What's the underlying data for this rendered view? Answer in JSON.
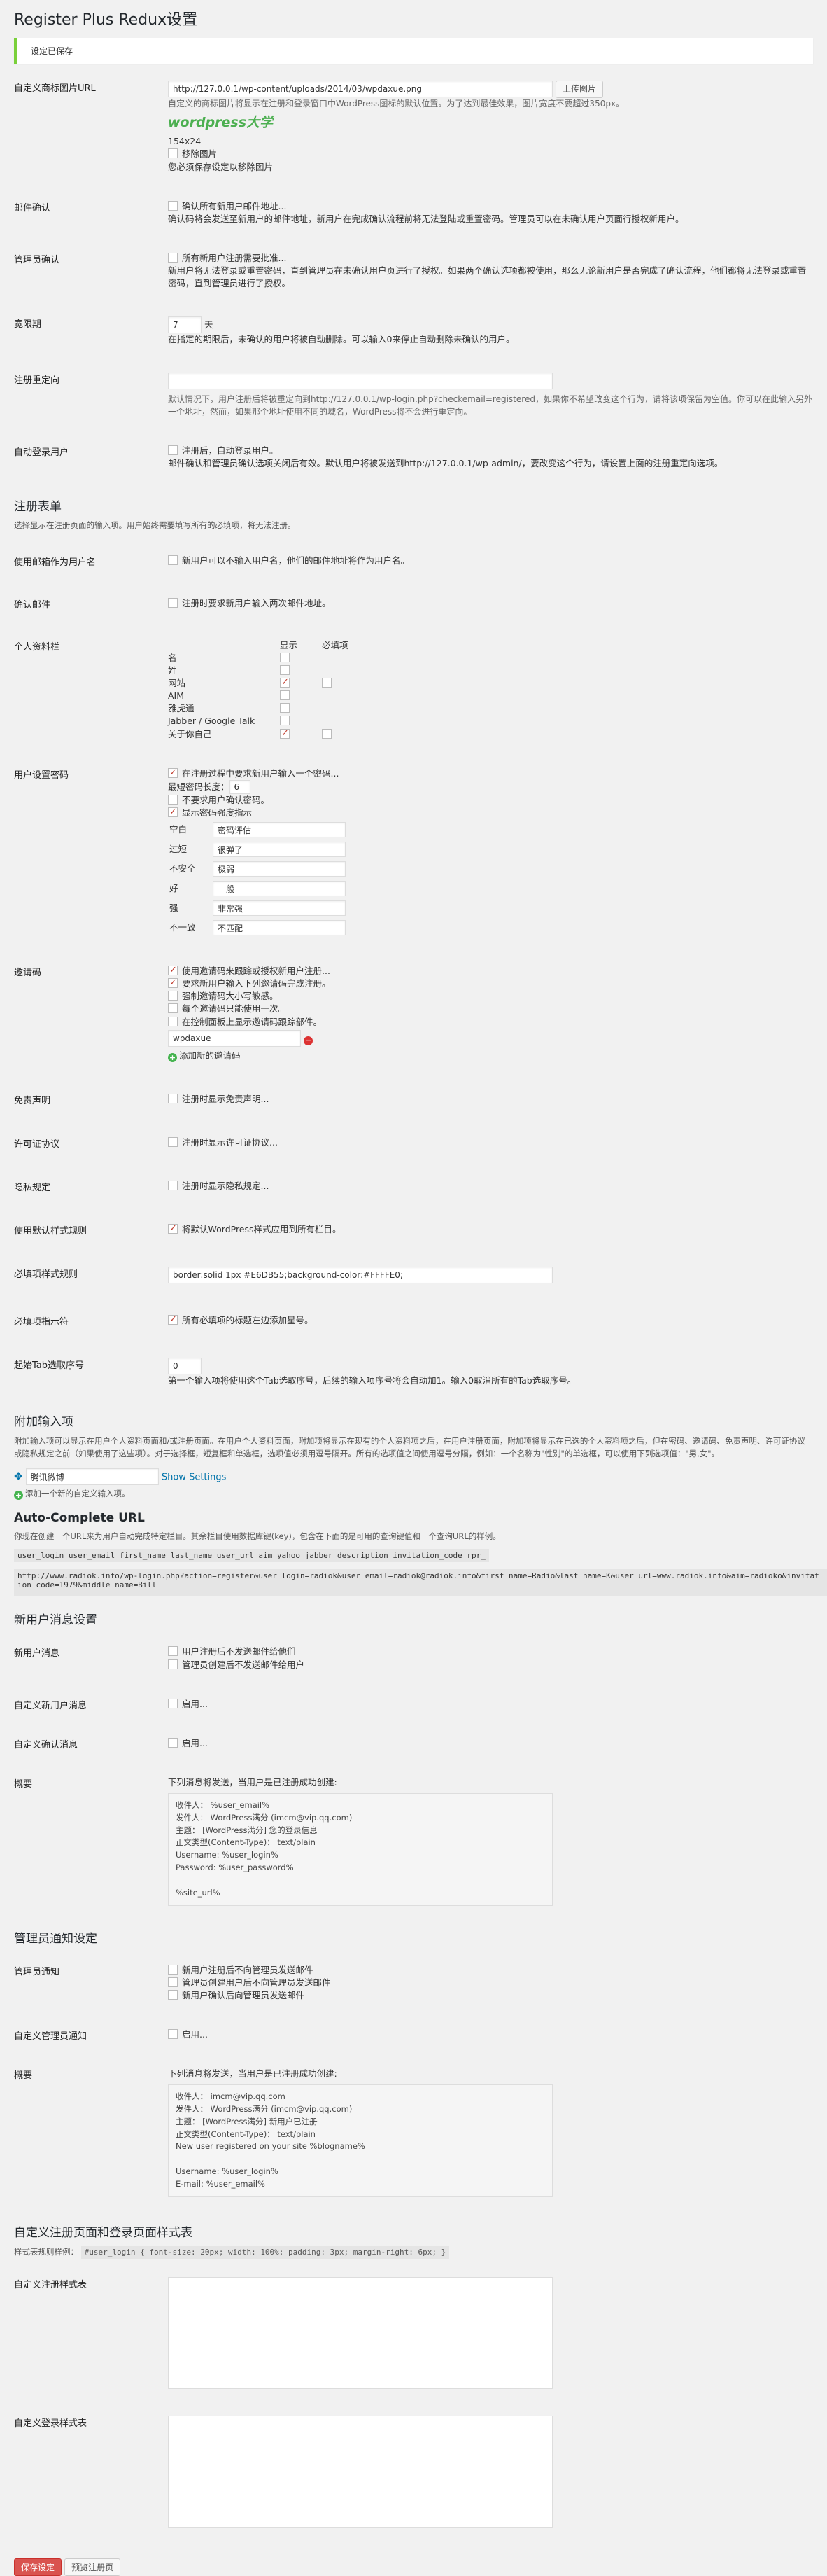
{
  "page": {
    "title": "Register Plus Redux设置",
    "notice": "设定已保存"
  },
  "logo": {
    "label": "自定义商标图片URL",
    "value": "http://127.0.0.1/wp-content/uploads/2014/03/wpdaxue.png",
    "upload_button": "上传图片",
    "desc": "自定义的商标图片将显示在注册和登录窗口中WordPress图标的默认位置。为了达到最佳效果，图片宽度不要超过350px。",
    "image_text": "wordpress大学",
    "size": "154x24",
    "remove_label": "移除图片",
    "remove_note": "您必须保存设定以移除图片"
  },
  "email_verify": {
    "label": "邮件确认",
    "option": "确认所有新用户邮件地址...",
    "desc": "确认码将会发送至新用户的邮件地址，新用户在完成确认流程前将无法登陆或重置密码。管理员可以在未确认用户页面行授权新用户。"
  },
  "admin_verify": {
    "label": "管理员确认",
    "option": "所有新用户注册需要批准...",
    "desc": "新用户将无法登录或重置密码，直到管理员在未确认用户页进行了授权。如果两个确认选项都被使用，那么无论新用户是否完成了确认流程，他们都将无法登录或重置密码，直到管理员进行了授权。"
  },
  "grace": {
    "label": "宽限期",
    "value": "7",
    "unit": "天",
    "desc": "在指定的期限后，未确认的用户将被自动删除。可以输入0来停止自动删除未确认的用户。"
  },
  "redirect": {
    "label": "注册重定向",
    "desc": "默认情况下，用户注册后将被重定向到http://127.0.0.1/wp-login.php?checkemail=registered，如果你不希望改变这个行为，请将该项保留为空值。你可以在此输入另外一个地址，然而，如果那个地址使用不同的域名，WordPress将不会进行重定向。"
  },
  "autologin": {
    "label": "自动登录用户",
    "option": "注册后，自动登录用户。",
    "desc": "邮件确认和管理员确认选项关闭后有效。默认用户将被发送到http://127.0.0.1/wp-admin/，要改变这个行为，请设置上面的注册重定向选项。"
  },
  "reg_form": {
    "heading": "注册表单",
    "desc": "选择显示在注册页面的输入项。用户始终需要填写所有的必填项，将无法注册。",
    "email_username": {
      "label": "使用邮箱作为用户名",
      "option": "新用户可以不输入用户名，他们的邮件地址将作为用户名。"
    },
    "confirm_email": {
      "label": "确认邮件",
      "option": "注册时要求新用户输入两次邮件地址。"
    },
    "profile": {
      "label": "个人资料栏",
      "col_show": "显示",
      "col_required": "必填项",
      "fields": [
        {
          "name": "名",
          "show": false,
          "req": null
        },
        {
          "name": "姓",
          "show": false,
          "req": null
        },
        {
          "name": "网站",
          "show": true,
          "req": false
        },
        {
          "name": "AIM",
          "show": false,
          "req": null
        },
        {
          "name": "雅虎通",
          "show": false,
          "req": null
        },
        {
          "name": "Jabber / Google Talk",
          "show": false,
          "req": null
        },
        {
          "name": "关于你自己",
          "show": true,
          "req": false
        }
      ]
    },
    "password": {
      "label": "用户设置密码",
      "option1": "在注册过程中要求新用户输入一个密码...",
      "minlen_label": "最短密码长度：",
      "minlen": "6",
      "option2": "不要求用户确认密码。",
      "option3": "显示密码强度指示",
      "strength": [
        {
          "key": "空白",
          "value": "密码评估"
        },
        {
          "key": "过短",
          "value": "很弹了"
        },
        {
          "key": "不安全",
          "value": "极弱"
        },
        {
          "key": "好",
          "value": "一般"
        },
        {
          "key": "强",
          "value": "非常强"
        },
        {
          "key": "不一致",
          "value": "不匹配"
        }
      ]
    },
    "invite": {
      "label": "邀请码",
      "options": [
        {
          "text": "使用邀请码来跟踪或授权新用户注册...",
          "checked": true
        },
        {
          "text": "要求新用户输入下列邀请码完成注册。",
          "checked": true
        },
        {
          "text": "强制邀请码大小写敏感。",
          "checked": false
        },
        {
          "text": "每个邀请码只能使用一次。",
          "checked": false
        },
        {
          "text": "在控制面板上显示邀请码跟踪部件。",
          "checked": false
        }
      ],
      "code": "wpdaxue",
      "add_link": "添加新的邀请码"
    },
    "disclaimer": {
      "label": "免责声明",
      "option": "注册时显示免责声明..."
    },
    "license": {
      "label": "许可证协议",
      "option": "注册时显示许可证协议..."
    },
    "privacy": {
      "label": "隐私规定",
      "option": "注册时显示隐私规定..."
    },
    "default_style": {
      "label": "使用默认样式规则",
      "option": "将默认WordPress样式应用到所有栏目。"
    },
    "required_style": {
      "label": "必填项样式规则",
      "value": "border:solid 1px #E6DB55;background-color:#FFFFE0;"
    },
    "required_marker": {
      "label": "必填项指示符",
      "option": "所有必填项的标题左边添加星号。"
    },
    "tabindex": {
      "label": "起始Tab选取序号",
      "value": "0",
      "desc": "第一个输入项将使用这个Tab选取序号，后续的输入项序号将会自动加1。输入0取消所有的Tab选取序号。"
    }
  },
  "extra": {
    "heading": "附加输入项",
    "desc": "附加输入项可以显示在用户个人资料页面和/或注册页面。在用户个人资料页面，附加项将显示在现有的个人资料项之后，在用户注册页面，附加项将显示在已选的个人资料项之后，但在密码、邀请码、免责声明、许可证协议或隐私规定之前（如果使用了这些项）。对于选择框，短复框和单选框，选项值必须用逗号隔开。所有的选项值之间使用逗号分隔，例如：一个名称为\"性别\"的单选框，可以使用下列选项值：\"男,女\"。",
    "field_name": "腾讯微博",
    "show_settings": "Show Settings",
    "add_link": "添加一个新的自定义输入项。"
  },
  "autocomplete": {
    "heading": "Auto-Complete URL",
    "desc": "你现在创建一个URL来为用户自动完成特定栏目。其余栏目使用数据库键(key)，包含在下面的是可用的查询键值和一个查询URL的样例。",
    "keys": "user_login user_email first_name last_name user_url aim yahoo jabber description invitation_code rpr_",
    "url": "http://www.radiok.info/wp-login.php?action=register&user_login=radiok&user_email=radiok@radiok.info&first_name=Radio&last_name=K&user_url=www.radiok.info&aim=radioko&invitation_code=1979&middle_name=Bill"
  },
  "user_msg": {
    "heading": "新用户消息设置",
    "label": "新用户消息",
    "option1": "用户注册后不发送邮件给他们",
    "option2": "管理员创建后不发送邮件给用户",
    "custom_label": "自定义新用户消息",
    "custom_option": "启用...",
    "verify_label": "自定义确认消息",
    "verify_option": "启用...",
    "summary_label": "概要",
    "summary_desc": "下列消息将发送，当用户是已注册成功创建:",
    "summary_body": "收件人： %user_email%\n发件人： WordPress满分 (imcm@vip.qq.com)\n主题： [WordPress满分] 您的登录信息\n正文类型(Content-Type)： text/plain\nUsername: %user_login%\nPassword: %user_password%\n\n%site_url%"
  },
  "admin_msg": {
    "heading": "管理员通知设定",
    "label": "管理员通知",
    "options": [
      "新用户注册后不向管理员发送邮件",
      "管理员创建用户后不向管理员发送邮件",
      "新用户确认后向管理员发送邮件"
    ],
    "custom_label": "自定义管理员通知",
    "custom_option": "启用...",
    "summary_label": "概要",
    "summary_desc": "下列消息将发送，当用户是已注册成功创建:",
    "summary_body": "收件人： imcm@vip.qq.com\n发件人： WordPress满分 (imcm@vip.qq.com)\n主题： [WordPress满分] 新用户已注册\n正文类型(Content-Type)： text/plain\nNew user registered on your site %blogname%\n\nUsername: %user_login%\nE-mail: %user_email%"
  },
  "css": {
    "heading": "自定义注册页面和登录页面样式表",
    "example_label": "样式表规则样例：",
    "example": "#user_login { font-size: 20px; width: 100%; padding: 3px; margin-right: 6px; }",
    "reg_label": "自定义注册样式表",
    "login_label": "自定义登录样式表"
  },
  "footer": {
    "save": "保存设定",
    "preview": "预览注册页"
  },
  "colors": {
    "accent": "#d9534f",
    "notice": "#7ad03a",
    "logo": "#4caf50"
  }
}
